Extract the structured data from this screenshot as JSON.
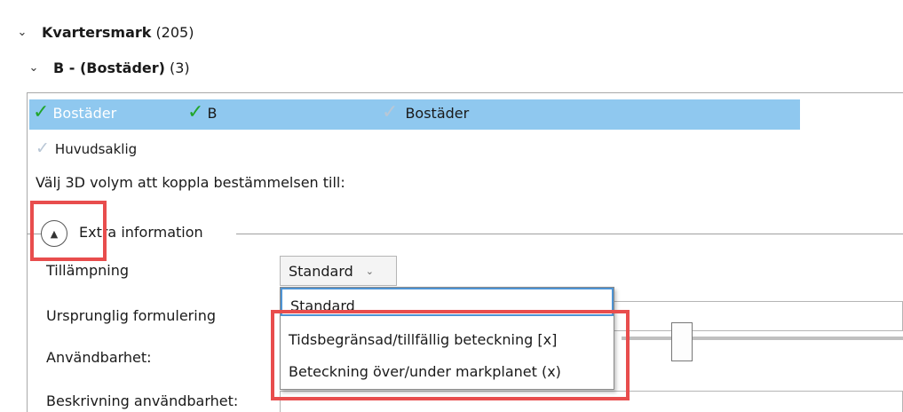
{
  "tree": {
    "level1": {
      "name": "Kvartersmark",
      "count": "(205)"
    },
    "level2": {
      "name": "B - (Bostäder)",
      "count": "(3)"
    }
  },
  "selection_row": {
    "items": [
      "Bostäder",
      "B",
      "Bostäder"
    ]
  },
  "sub_item": {
    "label": "Huvudsaklig"
  },
  "hint": "Välj 3D volym att koppla bestämmelsen till:",
  "expander": {
    "title": "Extra information"
  },
  "fields": {
    "tillampning": "Tillämpning",
    "ursprunglig": "Ursprunglig formulering",
    "anvandbarhet": "Användbarhet:",
    "beskrivning": "Beskrivning användbarhet:"
  },
  "combo": {
    "selected": "Standard"
  },
  "dropdown": {
    "options": [
      "Standard",
      "Tidsbegränsad/tillfällig beteckning [x]",
      "Beteckning över/under markplanet (x)"
    ]
  },
  "icons": {
    "chevron": "chevron-down-icon",
    "check": "checkmark-icon",
    "collapse": "collapse-up-icon"
  },
  "colors": {
    "selection": "#8fc8ef",
    "check_green": "#20a52a",
    "highlight_red": "#e84d4d",
    "dropdown_focus": "#4f94d4"
  }
}
